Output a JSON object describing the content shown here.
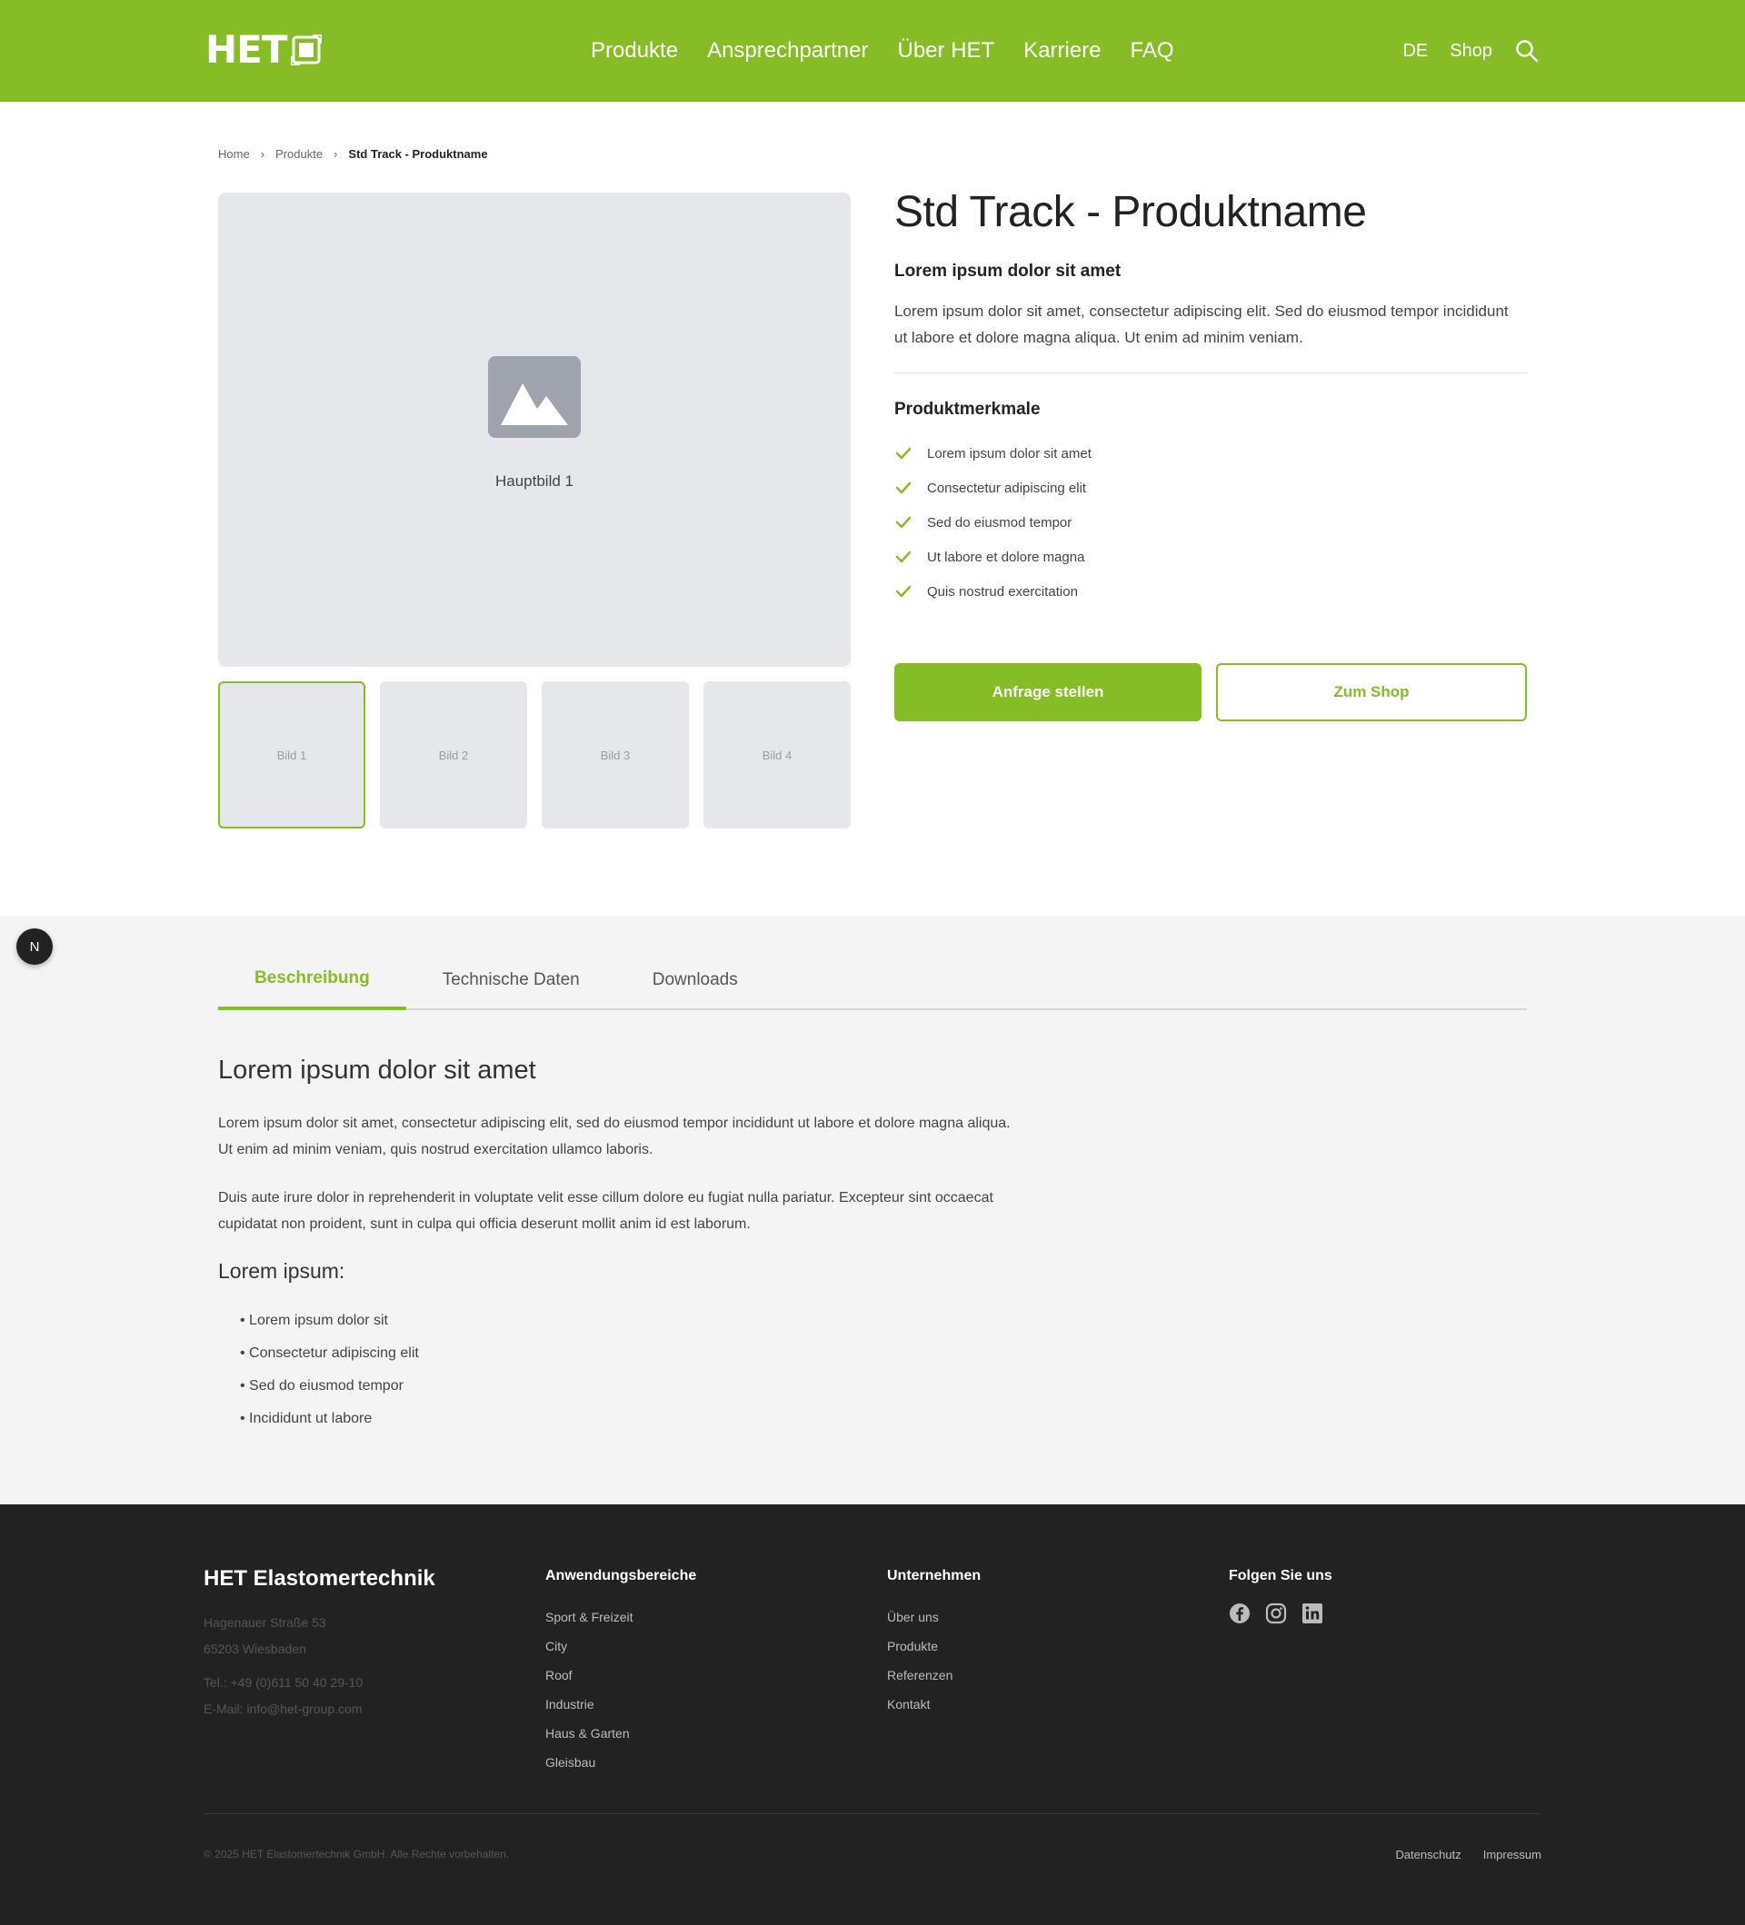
{
  "colors": {
    "brand": "#86bc25",
    "footer_bg": "#222222",
    "section_bg": "#f4f4f4"
  },
  "header": {
    "logo_text": "HET",
    "nav": [
      "Produkte",
      "Ansprechpartner",
      "Über HET",
      "Karriere",
      "FAQ"
    ],
    "language": "DE",
    "shop": "Shop"
  },
  "breadcrumb": {
    "home": "Home",
    "products": "Produkte",
    "current": "Std Track - Produktname"
  },
  "gallery": {
    "main_label": "Hauptbild 1",
    "thumbnails": [
      "Bild 1",
      "Bild 2",
      "Bild 3",
      "Bild 4"
    ]
  },
  "product": {
    "title": "Std Track - Produktname",
    "subtitle": "Lorem ipsum dolor sit amet",
    "description": "Lorem ipsum dolor sit amet, consectetur adipiscing elit. Sed do eiusmod tempor incididunt ut labore et dolore magna aliqua. Ut enim ad minim veniam.",
    "features_title": "Produktmerkmale",
    "features": [
      "Lorem ipsum dolor sit amet",
      "Consectetur adipiscing elit",
      "Sed do eiusmod tempor",
      "Ut labore et dolore magna",
      "Quis nostrud exercitation"
    ],
    "cta_primary": "Anfrage stellen",
    "cta_secondary": "Zum Shop"
  },
  "floating_badge": "N",
  "tabs": [
    "Beschreibung",
    "Technische Daten",
    "Downloads"
  ],
  "description": {
    "heading": "Lorem ipsum dolor sit amet",
    "p1": "Lorem ipsum dolor sit amet, consectetur adipiscing elit, sed do eiusmod tempor incididunt ut labore et dolore magna aliqua. Ut enim ad minim veniam, quis nostrud exercitation ullamco laboris.",
    "p2": "Duis aute irure dolor in reprehenderit in voluptate velit esse cillum dolore eu fugiat nulla pariatur. Excepteur sint occaecat cupidatat non proident, sunt in culpa qui officia deserunt mollit anim id est laborum.",
    "subheading": "Lorem ipsum:",
    "list": [
      "• Lorem ipsum dolor sit",
      "• Consectetur adipiscing elit",
      "• Sed do eiusmod tempor",
      "• Incididunt ut labore"
    ]
  },
  "footer": {
    "brand": "HET Elastomertechnik",
    "street": "Hagenauer Straße 53",
    "city": "65203 Wiesbaden",
    "phone": "Tel.: +49 (0)611 50 40 29-10",
    "email": "E-Mail: info@het-group.com",
    "col1_title": "Anwendungsbereiche",
    "col1_links": [
      "Sport & Freizeit",
      "City",
      "Roof",
      "Industrie",
      "Haus & Garten",
      "Gleisbau"
    ],
    "col2_title": "Unternehmen",
    "col2_links": [
      "Über uns",
      "Produkte",
      "Referenzen",
      "Kontakt"
    ],
    "col3_title": "Folgen Sie uns",
    "copyright": "© 2025 HET Elastomertechnik GmbH. Alle Rechte vorbehalten.",
    "privacy": "Datenschutz",
    "imprint": "Impressum"
  }
}
